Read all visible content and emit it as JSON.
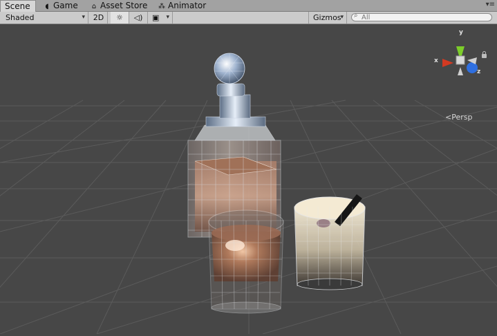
{
  "tabs": [
    {
      "label": "Scene",
      "icon": "scene-tab-icon",
      "active": true
    },
    {
      "label": "Game",
      "icon": "pacman-icon",
      "active": false
    },
    {
      "label": "Asset Store",
      "icon": "store-icon",
      "active": false
    },
    {
      "label": "Animator",
      "icon": "animator-icon",
      "active": false
    }
  ],
  "toolbar": {
    "shading_mode": "Shaded",
    "mode_2d": "2D",
    "gizmos_label": "Gizmos",
    "search_placeholder": "All"
  },
  "scene": {
    "projection_label": "Persp",
    "axes": {
      "x": "x",
      "y": "y",
      "z": "z"
    },
    "colors": {
      "background": "#474747",
      "x_axis": "#d43a22",
      "y_axis": "#7ccd2a",
      "z_axis": "#2f6fe0"
    }
  }
}
